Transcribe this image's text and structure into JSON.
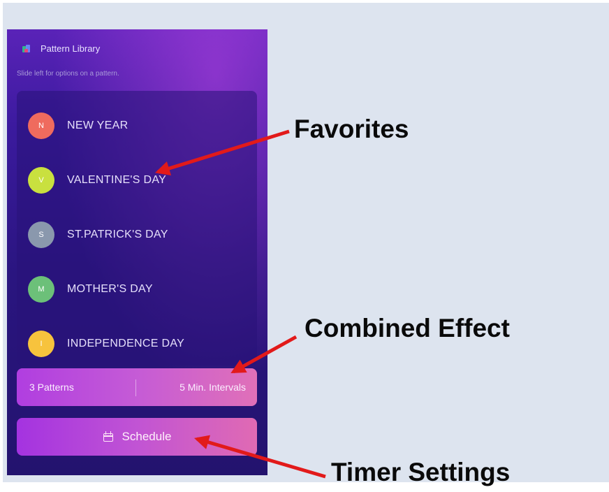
{
  "app": {
    "title": "Pattern Library",
    "hint": "Slide left for options on a pattern."
  },
  "patterns": [
    {
      "initial": "N",
      "name": "NEW YEAR",
      "color": "#ef6b5e"
    },
    {
      "initial": "V",
      "name": "VALENTINE'S DAY",
      "color": "#c9e03f"
    },
    {
      "initial": "S",
      "name": "ST.PATRICK'S DAY",
      "color": "#8a98ad"
    },
    {
      "initial": "M",
      "name": "MOTHER'S DAY",
      "color": "#6cc079"
    },
    {
      "initial": "I",
      "name": "INDEPENDENCE DAY",
      "color": "#f7c33d"
    }
  ],
  "combined": {
    "patterns_label": "3 Patterns",
    "interval_label": "5 Min. Intervals"
  },
  "schedule": {
    "label": "Schedule",
    "icon": "calendar-icon"
  },
  "annotations": {
    "favorites": "Favorites",
    "combined_effect": "Combined Effect",
    "timer_settings": "Timer Settings",
    "arrow_color": "#e21a1a"
  }
}
